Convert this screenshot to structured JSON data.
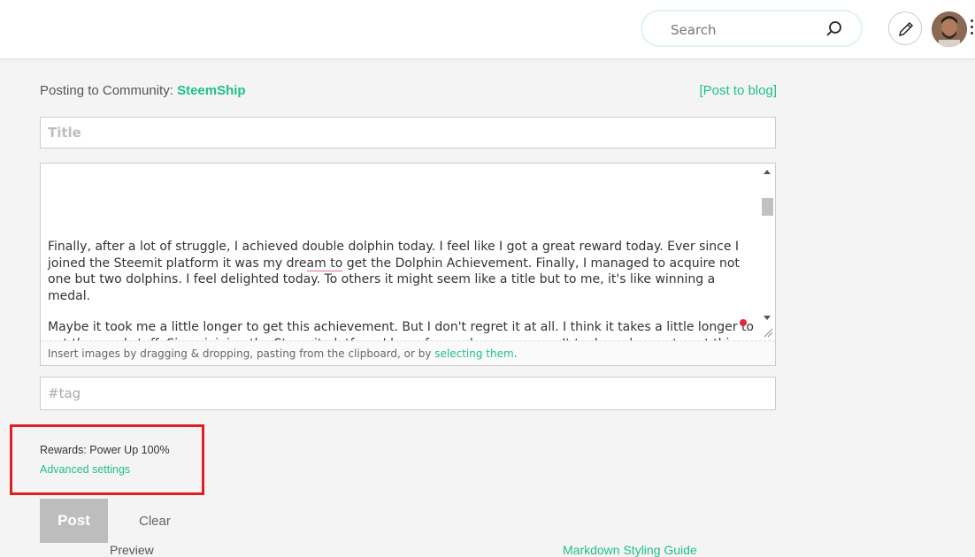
{
  "header": {
    "search_placeholder": "Search",
    "icons": [
      "search-icon",
      "pencil-icon",
      "avatar",
      "kebab-menu-icon"
    ]
  },
  "compose": {
    "posting_prefix": "Posting to Community: ",
    "community_name": "SteemShip",
    "post_to_blog": "[Post to blog]",
    "title_placeholder": "Title",
    "body_parts": {
      "p1_a": "Finally, after a lot of struggle, I achieved double dolphin today. I feel like I got a great reward today. Ever since I joined the Steemit platform it was my dre",
      "p1_misspelled": "am to",
      "p1_b": " get the Dolphin Achievement. Finally, I managed to acquire not one but two dolphins. I feel delighted today. To others it might seem like a title but to me, it's like winning a medal.",
      "p2": "Maybe it took me a little longer to get this achievement. But I don't regret it at all. I think it takes a little longer to get the good stuff. Since joining the Steemit platform I have focused on power-up. It took me longer to get this far because my starting amount was much lower. But since I started getting support from Steem Seed I've been growing fast."
    },
    "drop_note_prefix": "Insert images by dragging & dropping, pasting from the clipboard, or by ",
    "drop_note_link": "selecting them",
    "drop_note_suffix": ".",
    "tag_placeholder": "#tag",
    "rewards": "Rewards: Power Up 100%",
    "advanced_settings": "Advanced settings",
    "post_button": "Post",
    "clear_button": "Clear",
    "preview": "Preview",
    "markdown_guide": "Markdown Styling Guide"
  },
  "colors": {
    "accent": "#1fbf8f",
    "highlight_box": "#e02020",
    "post_button_bg": "#bdbdbd"
  }
}
